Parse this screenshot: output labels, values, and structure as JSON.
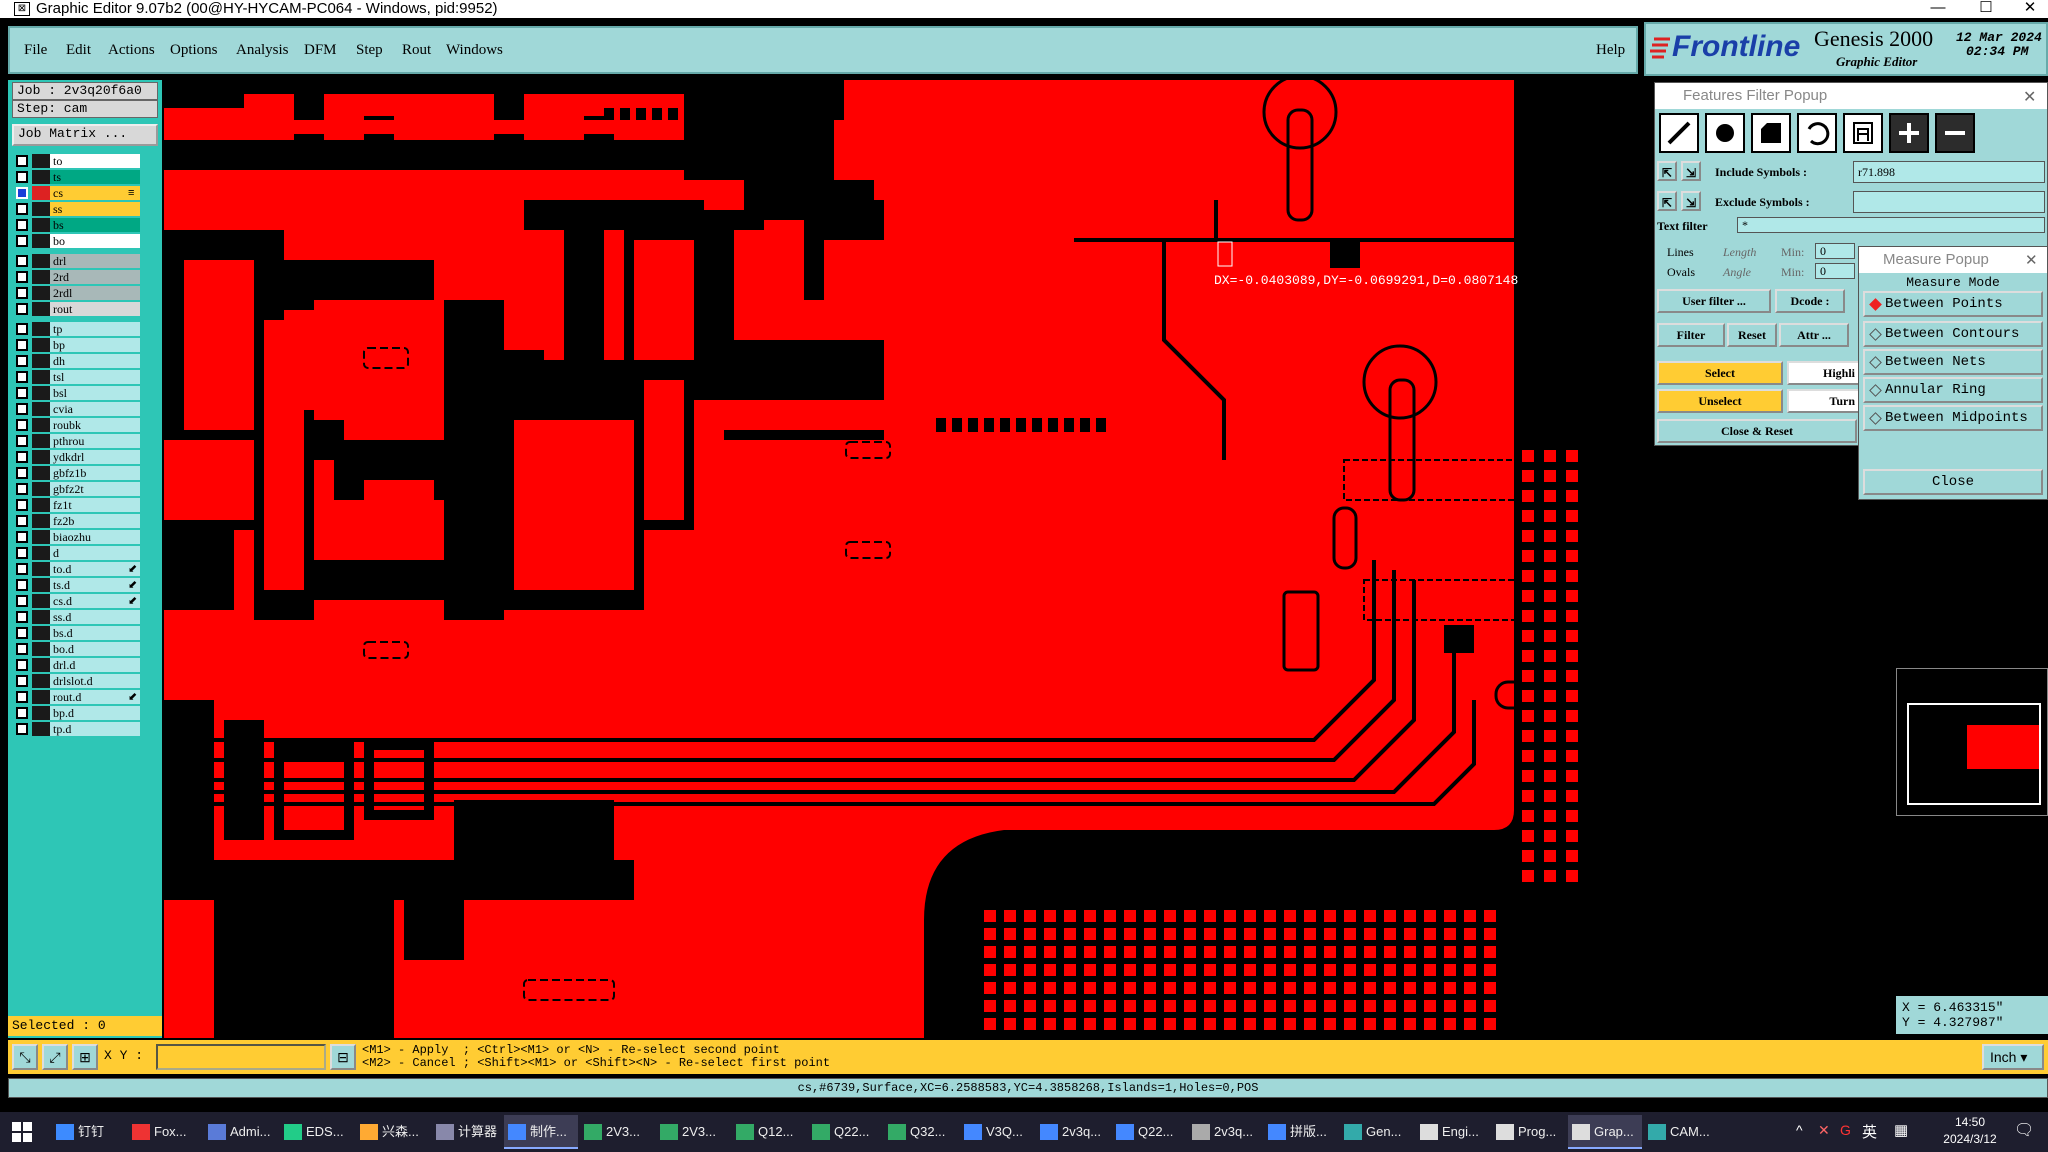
{
  "window": {
    "title": "Graphic Editor 9.07b2 (00@HY-HYCAM-PC064 - Windows, pid:9952)",
    "minimize": "—",
    "maximize": "☐",
    "close": "✕"
  },
  "menu": {
    "items": [
      "File",
      "Edit",
      "Actions",
      "Options",
      "Analysis",
      "DFM",
      "Step",
      "Rout",
      "Windows"
    ],
    "help": "Help"
  },
  "banner": {
    "brand": "Frontline",
    "product": "Genesis 2000",
    "subtitle": "Graphic Editor",
    "date": "12 Mar 2024",
    "time": "02:34 PM"
  },
  "left_panel": {
    "job": "Job : 2v3q20f6a0",
    "step": "Step: cam",
    "job_matrix": "Job Matrix ...",
    "selected": "Selected : 0",
    "layers": [
      {
        "name": "to",
        "color": "#ffffff",
        "mark": ""
      },
      {
        "name": "ts",
        "color": "#00a884",
        "mark": ""
      },
      {
        "name": "cs",
        "color": "#ffcc33",
        "mark": "≡",
        "active": true
      },
      {
        "name": "ss",
        "color": "#ffcc33",
        "mark": ""
      },
      {
        "name": "bs",
        "color": "#00a884",
        "mark": ""
      },
      {
        "name": "bo",
        "color": "#ffffff",
        "mark": ""
      },
      {
        "name": "drl",
        "color": "#a8b8b8",
        "mark": "",
        "gap": true
      },
      {
        "name": "2rd",
        "color": "#a8b8b8",
        "mark": ""
      },
      {
        "name": "2rdl",
        "color": "#a8b8b8",
        "mark": ""
      },
      {
        "name": "rout",
        "color": "#d8d8d8",
        "mark": ""
      },
      {
        "name": "tp",
        "color": "#b0e8e8",
        "mark": "",
        "gap": true
      },
      {
        "name": "bp",
        "color": "#b0e8e8",
        "mark": ""
      },
      {
        "name": "dh",
        "color": "#b0e8e8",
        "mark": ""
      },
      {
        "name": "tsl",
        "color": "#b0e8e8",
        "mark": ""
      },
      {
        "name": "bsl",
        "color": "#b0e8e8",
        "mark": ""
      },
      {
        "name": "cvia",
        "color": "#b0e8e8",
        "mark": ""
      },
      {
        "name": "roubk",
        "color": "#b0e8e8",
        "mark": ""
      },
      {
        "name": "pthrou",
        "color": "#b0e8e8",
        "mark": ""
      },
      {
        "name": "ydkdrl",
        "color": "#b0e8e8",
        "mark": ""
      },
      {
        "name": "gbfz1b",
        "color": "#b0e8e8",
        "mark": ""
      },
      {
        "name": "gbfz2t",
        "color": "#b0e8e8",
        "mark": ""
      },
      {
        "name": "fz1t",
        "color": "#b0e8e8",
        "mark": ""
      },
      {
        "name": "fz2b",
        "color": "#b0e8e8",
        "mark": ""
      },
      {
        "name": "biaozhu",
        "color": "#b0e8e8",
        "mark": ""
      },
      {
        "name": "d",
        "color": "#b0e8e8",
        "mark": ""
      },
      {
        "name": "to.d",
        "color": "#b0e8e8",
        "mark": "⬋"
      },
      {
        "name": "ts.d",
        "color": "#b0e8e8",
        "mark": "⬋"
      },
      {
        "name": "cs.d",
        "color": "#b0e8e8",
        "mark": "⬋"
      },
      {
        "name": "ss.d",
        "color": "#b0e8e8",
        "mark": ""
      },
      {
        "name": "bs.d",
        "color": "#b0e8e8",
        "mark": ""
      },
      {
        "name": "bo.d",
        "color": "#b0e8e8",
        "mark": ""
      },
      {
        "name": "drl.d",
        "color": "#b0e8e8",
        "mark": ""
      },
      {
        "name": "drlslot.d",
        "color": "#b0e8e8",
        "mark": ""
      },
      {
        "name": "rout.d",
        "color": "#b0e8e8",
        "mark": "⬋"
      },
      {
        "name": "bp.d",
        "color": "#b0e8e8",
        "mark": ""
      },
      {
        "name": "tp.d",
        "color": "#b0e8e8",
        "mark": ""
      }
    ]
  },
  "canvas": {
    "measure_text": "DX=-0.0403089,DY=-0.0699291,D=0.0807148"
  },
  "features_filter": {
    "title": "Features Filter Popup",
    "include_label": "Include Symbols :",
    "include_value": "r71.898",
    "exclude_label": "Exclude Symbols :",
    "exclude_value": "",
    "text_filter_label": "Text filter",
    "text_filter_value": "*",
    "lines": "Lines",
    "ovals": "Ovals",
    "length": "Length",
    "angle": "Angle",
    "min": "Min:",
    "min_value": "0",
    "user_filter": "User filter ...",
    "dcode": "Dcode :",
    "filter": "Filter",
    "reset": "Reset",
    "attr": "Attr ...",
    "select": "Select",
    "highlight": "Highli",
    "unselect": "Unselect",
    "turn": "Turn",
    "close_reset": "Close & Reset"
  },
  "measure_popup": {
    "title": "Measure Popup",
    "mode_label": "Measure Mode",
    "modes": [
      "Between Points",
      "Between Contours",
      "Between Nets",
      "Annular Ring",
      "Between Midpoints"
    ],
    "close": "Close"
  },
  "coords": {
    "x": "X = 6.463315\"",
    "y": "Y = 4.327987\""
  },
  "bottom": {
    "xy_label": "X Y :",
    "hint1": "<M1> - Apply  ; <Ctrl><M1> or <N> - Re-select second point",
    "hint2": "<M2> - Cancel ; <Shift><M1> or <Shift><N> - Re-select first point",
    "units": "Inch",
    "status": "cs,#6739,Surface,XC=6.2588583,YC=4.3858268,Islands=1,Holes=0,POS"
  },
  "taskbar": {
    "items": [
      {
        "label": "钉钉",
        "color": "#3d8bff"
      },
      {
        "label": "Fox...",
        "color": "#e33"
      },
      {
        "label": "Admi...",
        "color": "#5a7bd8"
      },
      {
        "label": "EDS...",
        "color": "#2c8"
      },
      {
        "label": "兴森...",
        "color": "#fa3"
      },
      {
        "label": "计算器",
        "color": "#88a"
      },
      {
        "label": "制作...",
        "color": "#48f",
        "active": true
      },
      {
        "label": "2V3...",
        "color": "#3a6"
      },
      {
        "label": "2V3...",
        "color": "#3a6"
      },
      {
        "label": "Q12...",
        "color": "#3a6"
      },
      {
        "label": "Q22...",
        "color": "#3a6"
      },
      {
        "label": "Q32...",
        "color": "#3a6"
      },
      {
        "label": "V3Q...",
        "color": "#48f"
      },
      {
        "label": "2v3q...",
        "color": "#48f"
      },
      {
        "label": "Q22...",
        "color": "#48f"
      },
      {
        "label": "2v3q...",
        "color": "#aaa"
      },
      {
        "label": "拼版...",
        "color": "#48f"
      },
      {
        "label": "Gen...",
        "color": "#3aa"
      },
      {
        "label": "Engi...",
        "color": "#ddd"
      },
      {
        "label": "Prog...",
        "color": "#ddd"
      },
      {
        "label": "Grap...",
        "color": "#ddd",
        "active": true
      },
      {
        "label": "CAM...",
        "color": "#3aa"
      }
    ],
    "ime": "英",
    "time": "14:50",
    "date": "2024/3/12"
  }
}
